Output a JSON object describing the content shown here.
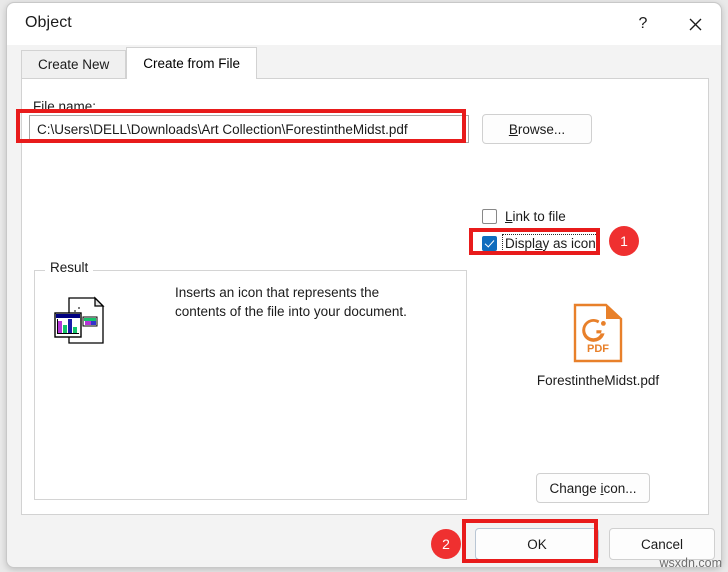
{
  "window": {
    "title": "Object",
    "help_label": "?",
    "close_label": "✕"
  },
  "tabs": [
    {
      "label": "Create New",
      "active": false
    },
    {
      "label": "Create from File",
      "active": true
    }
  ],
  "file_section": {
    "label": "File name:",
    "path_value": "C:\\Users\\DELL\\Downloads\\Art Collection\\ForestintheMidst.pdf",
    "path_placeholder": "",
    "browse_label": "Browse..."
  },
  "options": {
    "link_to_file": {
      "label": "Link to file",
      "checked": false
    },
    "display_as_icon": {
      "label": "Display as icon",
      "checked": true
    }
  },
  "result": {
    "group_title": "Result",
    "description": "Inserts an icon that represents the contents of the file into your document.",
    "doc_icon_name": "document-with-chart-icon"
  },
  "icon_preview": {
    "icon_name": "pdf-file-icon",
    "icon_badge_text": "PDF",
    "file_name": "ForestintheMidst.pdf",
    "change_icon_label": "Change icon...",
    "accent_color": "#e8802a"
  },
  "footer": {
    "ok_label": "OK",
    "cancel_label": "Cancel"
  },
  "annotations": {
    "badge_1": "1",
    "badge_2": "2",
    "color": "#e81b1b"
  },
  "watermark": "wsxdn.com"
}
